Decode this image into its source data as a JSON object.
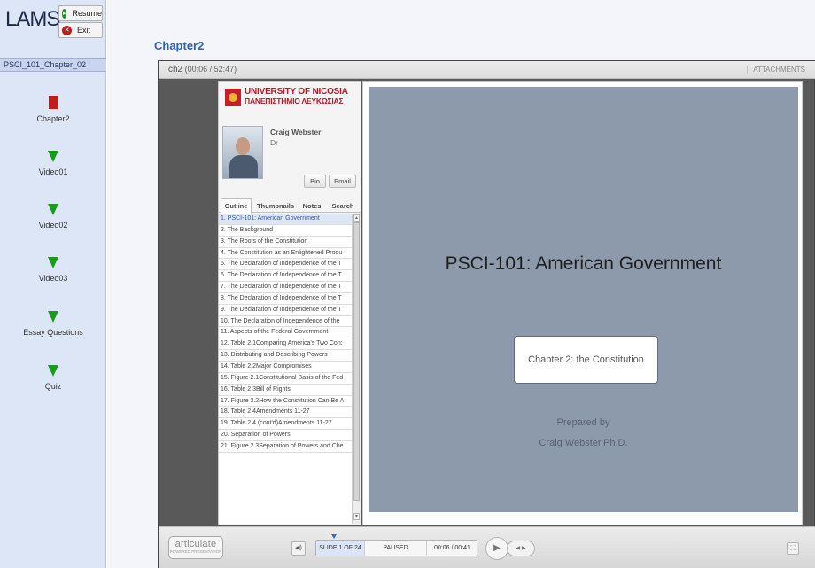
{
  "lams": {
    "logo_text": "LAMS",
    "resume_label": "Resume",
    "exit_label": "Exit",
    "sequence_title": "PSCI_101_Chapter_02",
    "activities": [
      {
        "label": "Chapter2",
        "marker": "red-square",
        "status": "current"
      },
      {
        "label": "Video01",
        "marker": "green-triangle",
        "status": "todo"
      },
      {
        "label": "Video02",
        "marker": "green-triangle",
        "status": "todo"
      },
      {
        "label": "Video03",
        "marker": "green-triangle",
        "status": "todo"
      },
      {
        "label": "Essay Questions",
        "marker": "green-triangle",
        "status": "todo"
      },
      {
        "label": "Quiz",
        "marker": "green-triangle",
        "status": "todo"
      }
    ]
  },
  "page": {
    "heading": "Chapter2"
  },
  "player": {
    "title_name": "ch2",
    "title_time": "(00:06 / 52:47)",
    "attachments_label": "ATTACHMENTS",
    "university_name": "UNIVERSITY OF NICOSIA",
    "university_name_gr": "ΠΑΝΕΠΙΣΤΗΜΙΟ ΛΕΥΚΩΣΙΑΣ",
    "presenter_name": "Craig Webster",
    "presenter_title": "Dr",
    "bio_label": "Bio",
    "email_label": "Email",
    "tabs": [
      "Outline",
      "Thumbnails",
      "Notes",
      "Search"
    ],
    "active_tab": "Outline",
    "outline": [
      "1. PSCI-101: American Government",
      "2. The Background",
      "3. The Roots of the Constitution",
      "4. The Constitution as an Enlightened Produ",
      "5. The Declaration of Independence of the T",
      "6. The Declaration of Independence of the T",
      "7. The Declaration of Independence of the T",
      "8. The Declaration of Independence of the T",
      "9. The Declaration of Independence of the T",
      "10. The Declaration of Independence of the",
      "11. Aspects of the Federal Government",
      "12. Table 2.1Comparing America's Two Con:",
      "13. Distributing and Describing Powers",
      "14. Table 2.2Major Compromises",
      "15. Figure 2.1Constitutional Basis of the Fed",
      "16. Table 2.3Bill of Rights",
      "17. Figure 2.2How the Constitution Can Be A",
      "18. Table 2.4Amendments 11-27",
      "19. Table 2.4 (cont'd)Amendments 11-27",
      "20. Separation of Powers",
      "21. Figure 2.3Separation of Powers and Che"
    ],
    "slide": {
      "title": "PSCI-101: American Government",
      "box_text": "Chapter 2: the Constitution",
      "prepared_label": "Prepared by",
      "author": "Craig Webster,Ph.D."
    },
    "controls": {
      "brand": "articulate",
      "brand_sub": "POWERED PRESENTATION",
      "slide_count": "SLIDE 1 OF 24",
      "state": "PAUSED",
      "time": "00:06 / 00:41"
    }
  },
  "colors": {
    "accent_heading": "#2a63b0",
    "current_marker": "#c11d1d",
    "todo_marker": "#1c9a1c",
    "slide_bg": "#8c9aab",
    "uni_red": "#b5192a"
  },
  "icons": {
    "resume": "resume-icon",
    "exit": "exit-icon",
    "volume": "volume-icon",
    "play": "play-icon",
    "fullscreen": "fullscreen-icon"
  }
}
